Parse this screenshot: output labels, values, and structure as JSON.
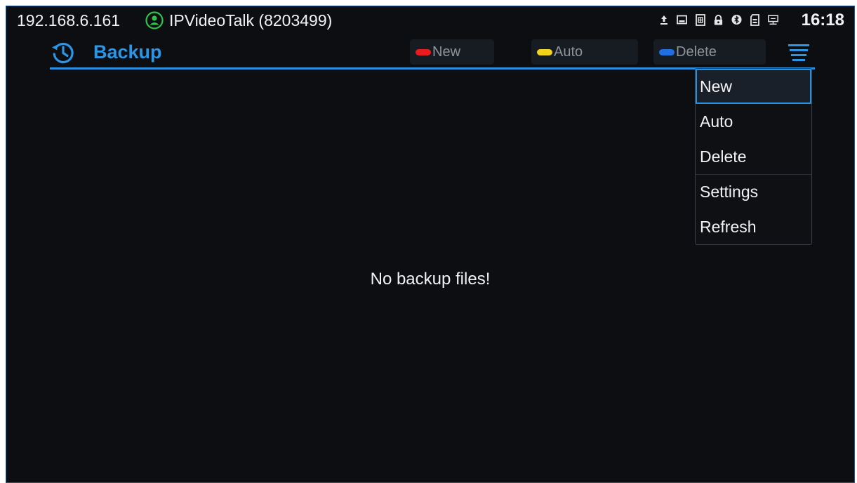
{
  "status_bar": {
    "ip_address": "192.168.6.161",
    "account_name": "IPVideoTalk (8203499)",
    "time": "16:18",
    "icons": [
      "upload-icon",
      "screen-icon",
      "sim-icon",
      "lock-icon",
      "bluetooth-icon",
      "sd-card-icon",
      "network-monitor-icon"
    ]
  },
  "header": {
    "title": "Backup",
    "title_icon": "history-icon",
    "accent_color": "#2b95e6"
  },
  "softkeys": [
    {
      "label": "New",
      "color": "#e81c1c"
    },
    {
      "label": "Auto",
      "color": "#f2d21b"
    },
    {
      "label": "Delete",
      "color": "#1f6fe0"
    }
  ],
  "main": {
    "empty_message": "No backup files!"
  },
  "menu": {
    "items": [
      {
        "label": "New",
        "selected": true
      },
      {
        "label": "Auto",
        "selected": false
      },
      {
        "label": "Delete",
        "selected": false
      },
      {
        "label": "Settings",
        "selected": false
      },
      {
        "label": "Refresh",
        "selected": false
      }
    ]
  }
}
